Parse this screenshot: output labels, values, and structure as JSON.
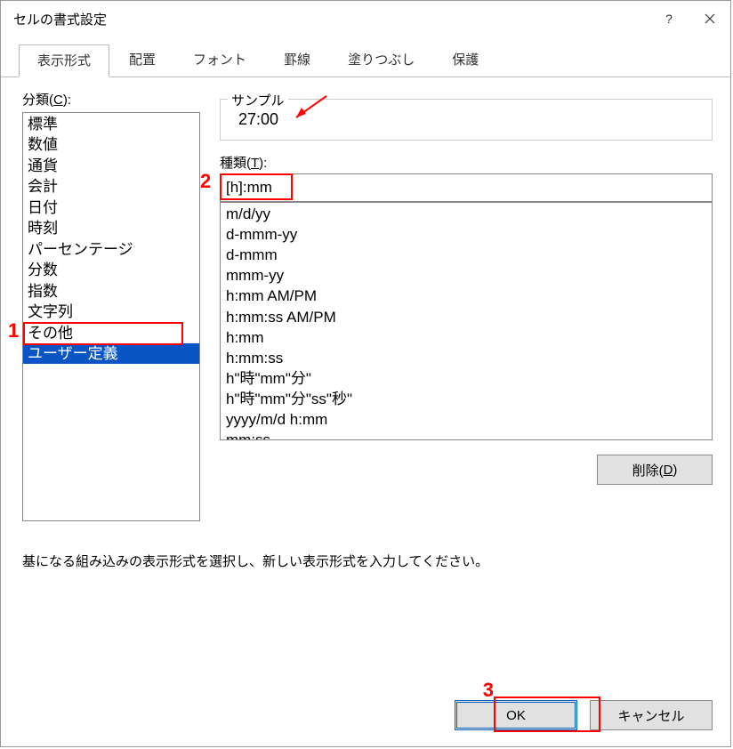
{
  "window": {
    "title": "セルの書式設定"
  },
  "tabs": [
    "表示形式",
    "配置",
    "フォント",
    "罫線",
    "塗りつぶし",
    "保護"
  ],
  "active_tab": 0,
  "category": {
    "label_pre": "分類(",
    "label_key": "C",
    "label_post": "):",
    "items": [
      "標準",
      "数値",
      "通貨",
      "会計",
      "日付",
      "時刻",
      "パーセンテージ",
      "分数",
      "指数",
      "文字列",
      "その他",
      "ユーザー定義"
    ],
    "selected_index": 11
  },
  "sample": {
    "legend": "サンプル",
    "value": "27:00"
  },
  "type": {
    "label_pre": "種類(",
    "label_key": "T",
    "label_post": "):",
    "value": "[h]:mm",
    "formats": [
      "m/d/yy",
      "d-mmm-yy",
      "d-mmm",
      "mmm-yy",
      "h:mm AM/PM",
      "h:mm:ss AM/PM",
      "h:mm",
      "h:mm:ss",
      "h\"時\"mm\"分\"",
      "h\"時\"mm\"分\"ss\"秒\"",
      "yyyy/m/d h:mm",
      "mm:ss"
    ]
  },
  "delete_btn": {
    "pre": "削除(",
    "key": "D",
    "post": ")"
  },
  "hint": "基になる組み込みの表示形式を選択し、新しい表示形式を入力してください。",
  "footer": {
    "ok": "OK",
    "cancel": "キャンセル"
  },
  "annotations": {
    "n1": "1",
    "n2": "2",
    "n3": "3"
  }
}
